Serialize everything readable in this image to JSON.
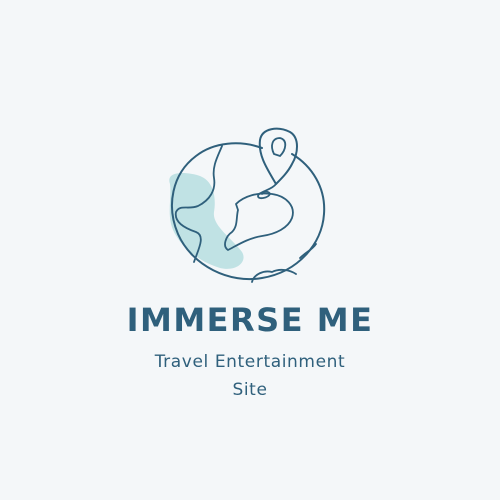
{
  "logo": {
    "name": "IMMERSE ME",
    "tagline_line1": "Travel Entertainment",
    "tagline_line2": "Site",
    "icons": [
      "globe-icon",
      "location-pin-icon"
    ],
    "colors": {
      "background": "#f4f7f9",
      "primary": "#2f607c",
      "accent": "#a9d8dc"
    }
  }
}
